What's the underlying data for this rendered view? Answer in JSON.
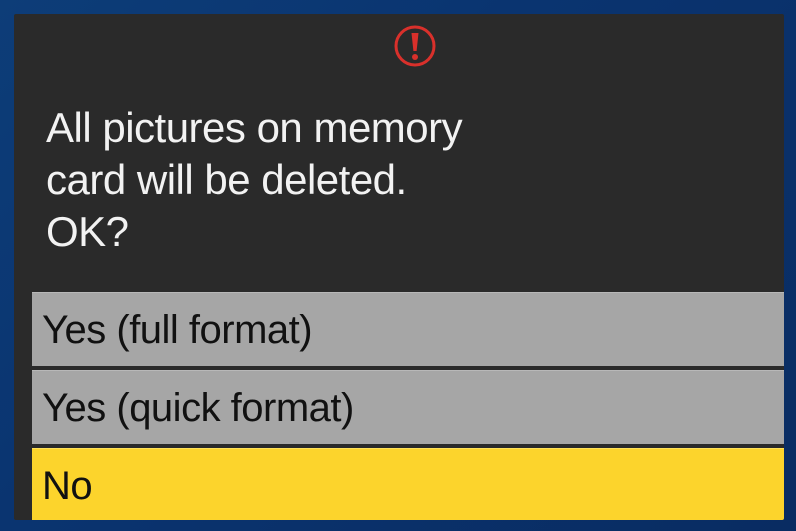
{
  "dialog": {
    "icon": "warning-exclamation-icon",
    "icon_color": "#d9302b",
    "message_lines": [
      "All pictures on memory",
      "card will be deleted.",
      "OK?"
    ],
    "options": [
      {
        "label": "Yes (full format)",
        "selected": false
      },
      {
        "label": "Yes (quick format)",
        "selected": false
      },
      {
        "label": "No",
        "selected": true
      }
    ],
    "highlight_color": "#fcd42c",
    "option_color": "#a6a6a6"
  }
}
